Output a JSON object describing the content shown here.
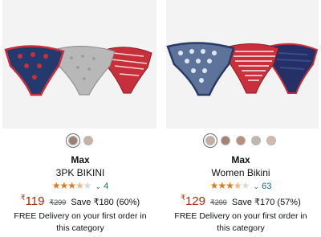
{
  "products": [
    {
      "brand": "Max",
      "title": "3PK BIKINI",
      "rating_value": 3.5,
      "rating_count": "4",
      "price_symbol": "₹",
      "price": "119",
      "mrp": "₹299",
      "save": "Save ₹180 (60%)",
      "delivery": "FREE Delivery on your first order in this category",
      "swatches": [
        "#9a7f73",
        "#c9b2a5"
      ],
      "colors": [
        "#233a6e",
        "#b8b8b8",
        "#c7303b"
      ]
    },
    {
      "brand": "Max",
      "title": "Women Bikini",
      "rating_value": 3.5,
      "rating_count": "63",
      "price_symbol": "₹",
      "price": "129",
      "mrp": "₹299",
      "save": "Save ₹170 (57%)",
      "delivery": "FREE Delivery on your first order in this category",
      "swatches": [
        "#c4aea2",
        "#a5836e",
        "#b98e7c",
        "#bdb7ae",
        "#d6b8a6"
      ],
      "colors": [
        "#5e7399",
        "#c9303c",
        "#243066"
      ]
    }
  ]
}
